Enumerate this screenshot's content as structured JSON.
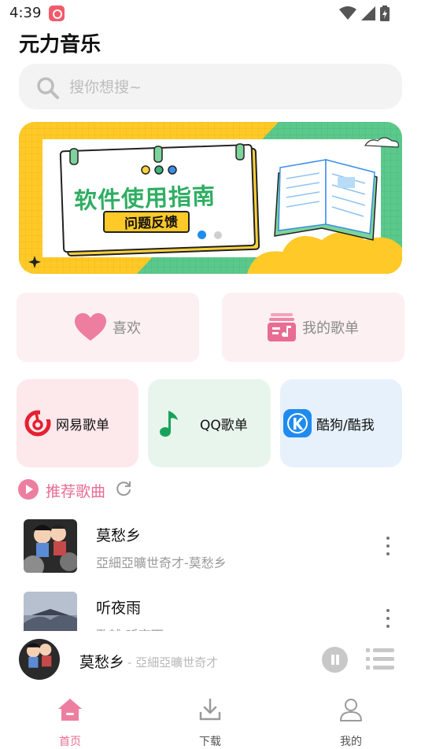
{
  "status": {
    "time": "4:39"
  },
  "app": {
    "title": "元力音乐"
  },
  "search": {
    "placeholder": "搜你想搜~"
  },
  "banner": {
    "title": "软件使用指南",
    "subtitle": "问题反馈",
    "slide_count": 2,
    "active_slide": 1
  },
  "quick": {
    "favorites": "喜欢",
    "my_playlists": "我的歌单"
  },
  "sources": {
    "netease": "网易歌单",
    "qq": "QQ歌单",
    "kugou": "酷狗/酷我"
  },
  "recommend": {
    "title": "推荐歌曲"
  },
  "songs": [
    {
      "title": "莫愁乡",
      "subtitle": "亞細亞曠世奇才-莫愁乡"
    },
    {
      "title": "听夜雨",
      "subtitle": "孔越-听夜雨"
    }
  ],
  "player": {
    "title": "莫愁乡",
    "artist": "- 亞細亞曠世奇才"
  },
  "nav": {
    "home": "首页",
    "download": "下载",
    "mine": "我的"
  },
  "colors": {
    "accent": "#e86c94",
    "banner_yellow": "#ffc928",
    "banner_green": "#5bc98c",
    "netease_red": "#e5202f",
    "qq_green": "#18a35a",
    "kugou_blue": "#1f8bef"
  },
  "icons": [
    "notification-icon",
    "wifi-icon",
    "signal-icon",
    "battery-icon",
    "search-icon",
    "heart-icon",
    "playlist-icon",
    "netease-icon",
    "qq-music-icon",
    "kugou-icon",
    "play-circle-icon",
    "refresh-icon",
    "more-icon",
    "pause-icon",
    "queue-icon",
    "home-icon",
    "download-icon",
    "user-icon"
  ]
}
